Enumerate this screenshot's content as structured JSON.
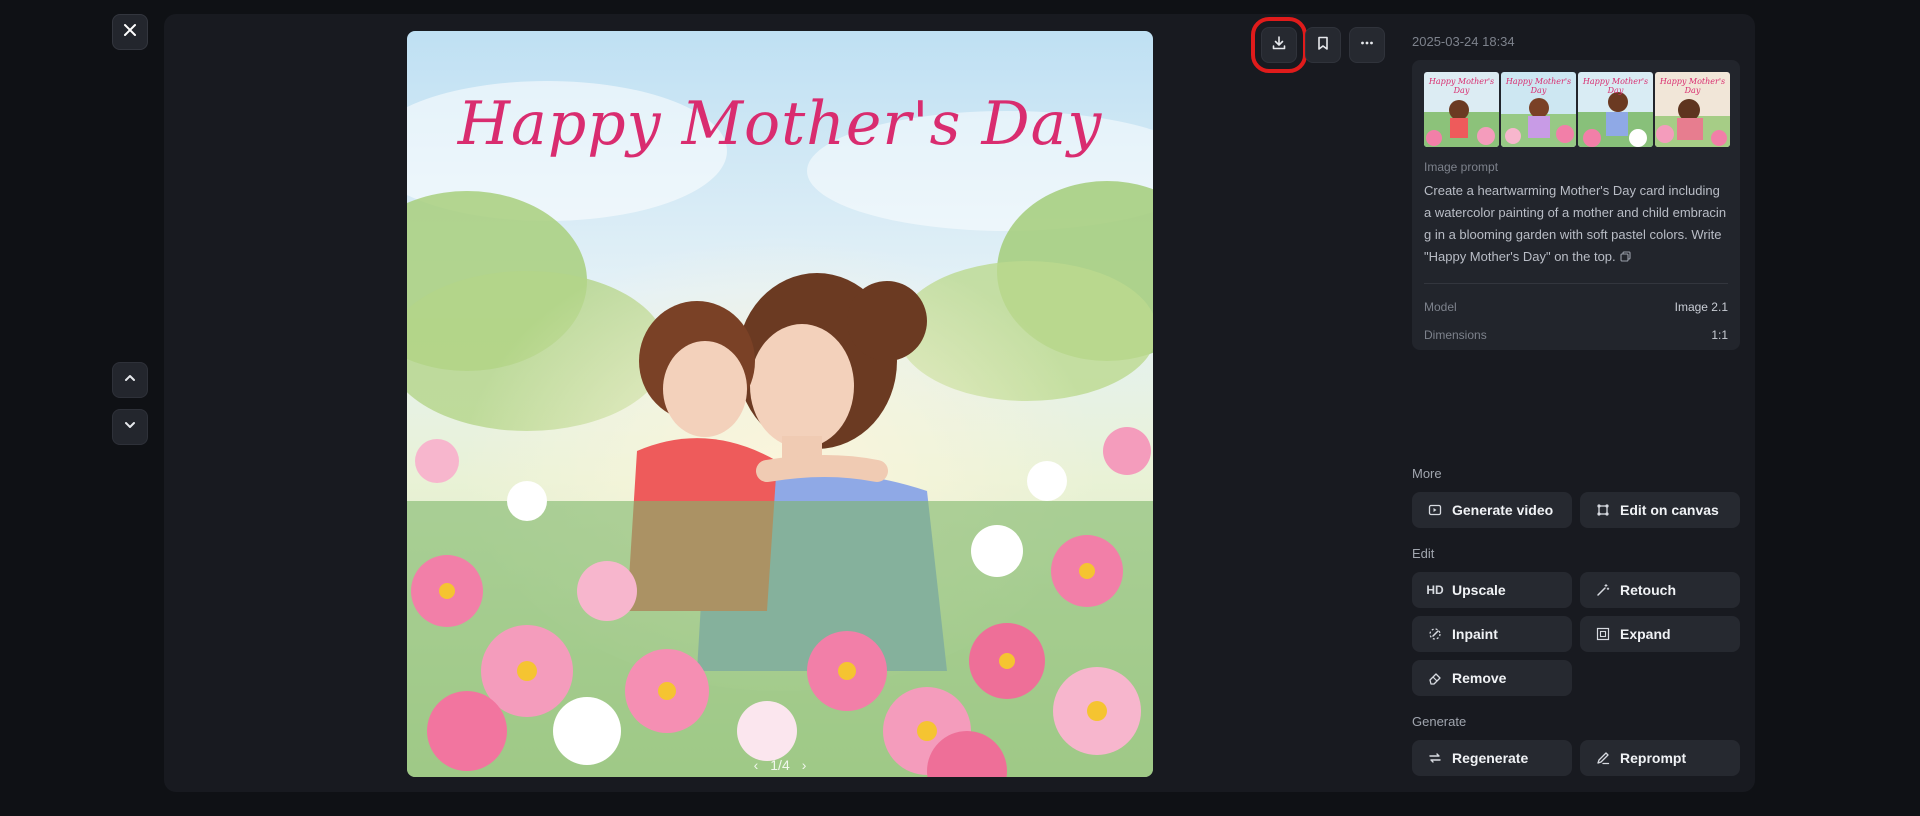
{
  "window": {
    "close_label": "Close"
  },
  "viewer": {
    "artwork_title": "Happy Mother's Day",
    "pager": {
      "current": "1",
      "total": "4",
      "text": "1/4"
    }
  },
  "toolbar": {
    "download_icon": "download-icon",
    "bookmark_icon": "bookmark-icon",
    "more_icon": "more-icon"
  },
  "details": {
    "timestamp": "2025-03-24 18:34",
    "thumbnails": [
      {
        "title": "Happy Mother's Day"
      },
      {
        "title": "Happy Mother's Day"
      },
      {
        "title": "Happy Mother's Day"
      },
      {
        "title": "Happy Mother's Day"
      }
    ],
    "prompt_label": "Image prompt",
    "prompt_text": "Create a heartwarming Mother's Day card including a watercolor painting of a mother and child embracing in a blooming garden with soft pastel colors. Write \"Happy Mother's Day\" on the top.",
    "model_label": "Model",
    "model_value": "Image 2.1",
    "dimensions_label": "Dimensions",
    "dimensions_value": "1:1"
  },
  "sections": {
    "more": "More",
    "edit": "Edit",
    "generate": "Generate"
  },
  "actions": {
    "generate_video": "Generate video",
    "edit_on_canvas": "Edit on canvas",
    "upscale": "Upscale",
    "upscale_icon_text": "HD",
    "retouch": "Retouch",
    "inpaint": "Inpaint",
    "expand": "Expand",
    "remove": "Remove",
    "regenerate": "Regenerate",
    "reprompt": "Reprompt"
  },
  "colors": {
    "background": "#0f1115",
    "panel": "#181a20",
    "card": "#22252c",
    "button": "#262930",
    "highlight": "#e01b1b",
    "title_pink": "#d92c6f"
  }
}
